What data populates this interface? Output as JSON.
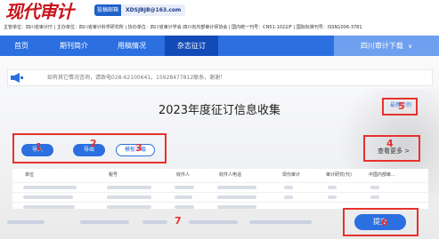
{
  "header": {
    "logo_text": "现代审计",
    "email_tag": "投稿邮箱",
    "email": "XDSJBJB@163.com",
    "sponsor_line": "主管单位：四川省审计厅 | 主办单位：四川省审计科学研究所 | 协办单位：四川省审计学会 四川省内部审计师协会 | 国内统一刊号：CN51-1022/F | 国际标准刊号：ISSN1006-3781"
  },
  "nav": {
    "items": [
      "首页",
      "期刊简介",
      "用稿情况",
      "杂志征订"
    ],
    "active_index": 3,
    "dropdown": "四川审计下载"
  },
  "notice": {
    "text": "如有其它情况咨询，请致电028-62100641，15928477812联系，谢谢！"
  },
  "main": {
    "title": "2023年度征订信息收集",
    "sample_link": "最新示例",
    "buttons": {
      "import": "导入",
      "export": "导出",
      "template": "模板下载"
    },
    "more_link": "查看更多 >"
  },
  "table": {
    "headers": [
      "单位",
      "税号",
      "收件人",
      "收件人电话",
      "现代审计",
      "审计研究(代)",
      "中国内部审..."
    ]
  },
  "footer": {
    "submit": "提交"
  },
  "annotations": [
    "1",
    "2",
    "3",
    "4",
    "5",
    "6",
    "7"
  ],
  "colors": {
    "accent": "#2b6fe0",
    "nav_active": "#124bb8",
    "annotation": "#e8312c",
    "logo": "#c8161d"
  }
}
